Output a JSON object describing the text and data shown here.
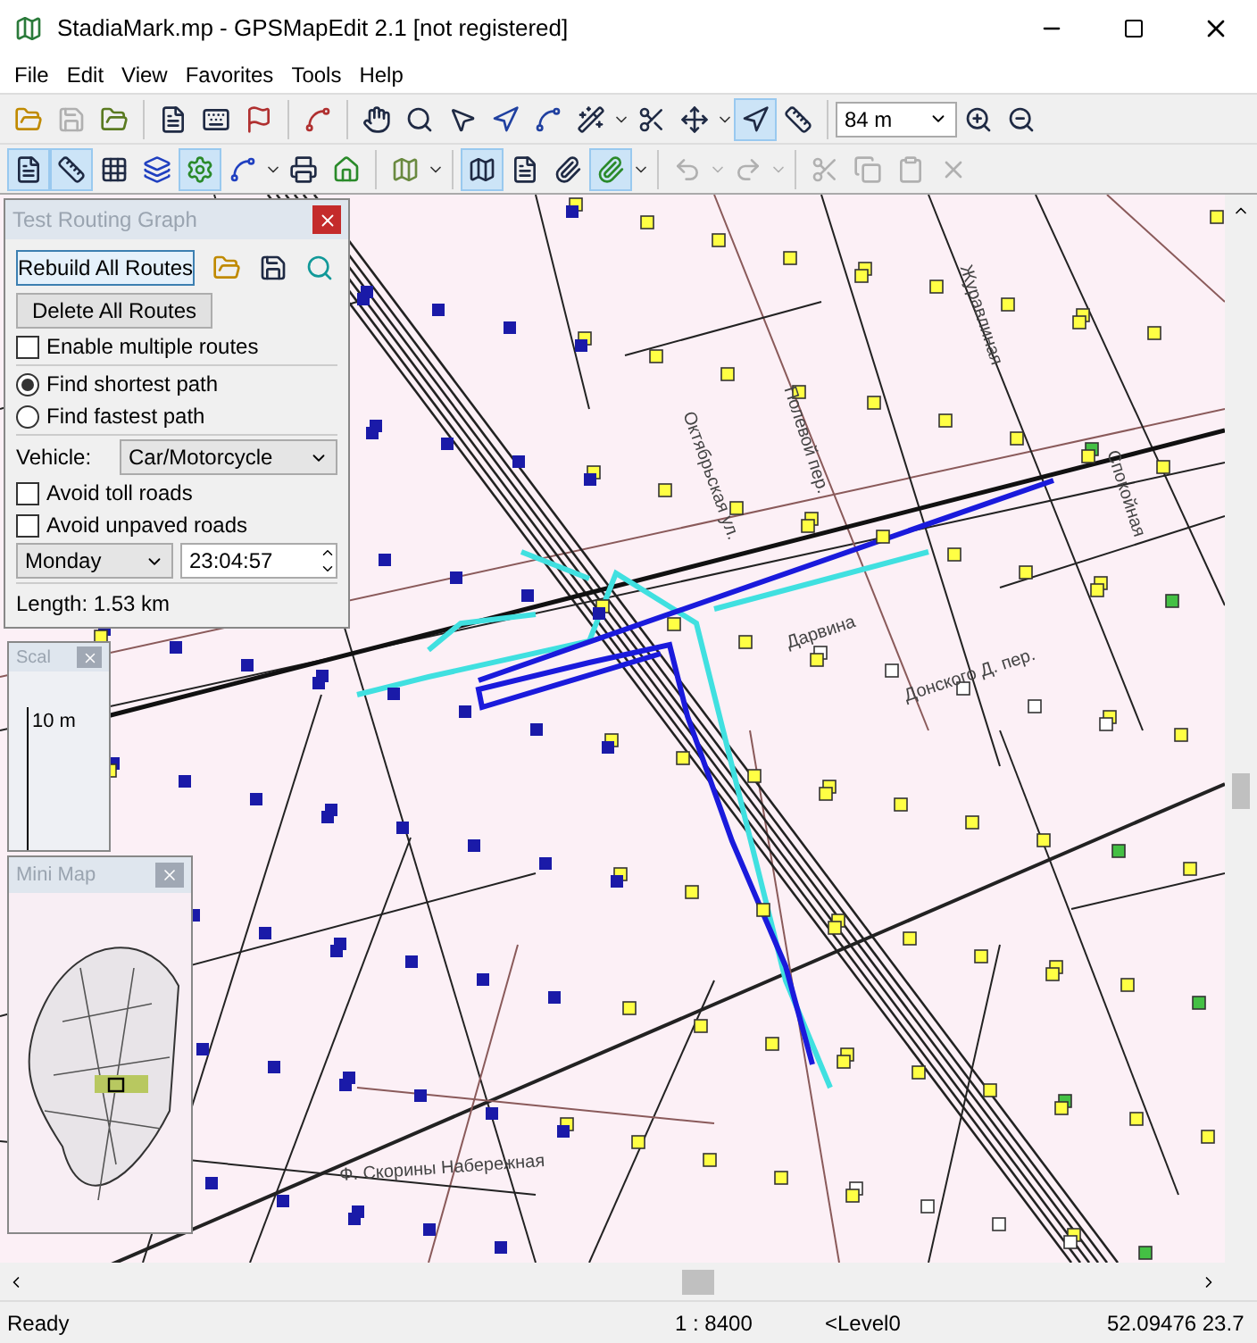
{
  "window": {
    "title": "StadiaMark.mp - GPSMapEdit 2.1 [not registered]"
  },
  "menu": [
    "File",
    "Edit",
    "View",
    "Favorites",
    "Tools",
    "Help"
  ],
  "toolbar": {
    "scale": "84 m",
    "edit_buttons_disabled": true
  },
  "routing_panel": {
    "title": "Test Routing Graph",
    "buttons": [
      "Rebuild All Routes",
      "Delete All Routes"
    ],
    "multiple_routes": {
      "label": "Enable multiple routes",
      "checked": false
    },
    "path_options": [
      {
        "label": "Find shortest path",
        "selected": true
      },
      {
        "label": "Find fastest path",
        "selected": false
      }
    ],
    "vehicle_label": "Vehicle:",
    "vehicle": "Car/Motorcycle",
    "avoid": [
      {
        "label": "Avoid toll roads",
        "checked": false
      },
      {
        "label": "Avoid unpaved roads",
        "checked": false
      }
    ],
    "day": "Monday",
    "time": "23:04:57",
    "length": "Length: 1.53 km"
  },
  "scale_panel": {
    "title": "Scal",
    "ruler_label": "10 m"
  },
  "mini_map": {
    "title": "Mini Map"
  },
  "map_labels": [
    "Октябрьская ул.",
    "Полевой пер.",
    "Журавлиная",
    "Дарвина",
    "Донского Д. пер.",
    "Спокойная",
    "Ф. Скорины Набережная"
  ],
  "status_bar": [
    "Ready",
    "1 : 8400",
    "<Level0",
    "52.09476 23.7"
  ]
}
